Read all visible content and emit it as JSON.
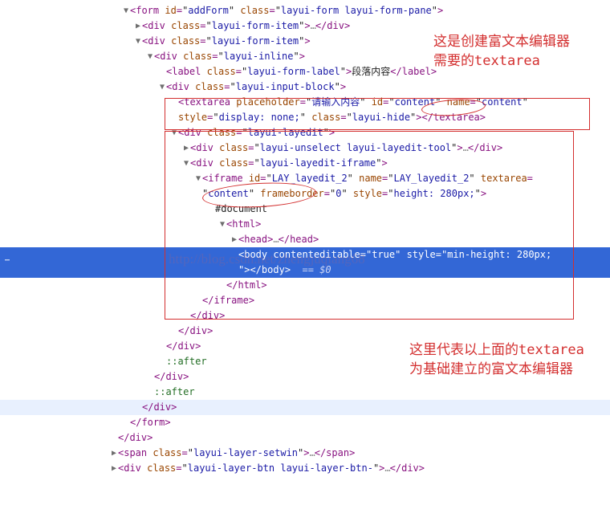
{
  "tree": {
    "form": {
      "id": "addForm",
      "class": "layui-form layui-form-pane"
    },
    "divA": {
      "class": "layui-form-item"
    },
    "divB": {
      "class": "layui-form-item"
    },
    "divC": {
      "class": "layui-inline"
    },
    "label": {
      "class": "layui-form-label",
      "text": "段落内容"
    },
    "divD": {
      "class": "layui-input-block"
    },
    "textarea": {
      "placeholder": "请输入内容",
      "id": "content",
      "name": "content",
      "style": "display: none;",
      "class": "layui-hide"
    },
    "divE": {
      "class": "layui-layedit"
    },
    "divF": {
      "class": "layui-unselect layui-layedit-tool"
    },
    "divG": {
      "class": "layui-layedit-iframe"
    },
    "iframe": {
      "id": "LAY_layedit_2",
      "name": "LAY_layedit_2",
      "textarea": "content",
      "frameborder": "0",
      "style": "height: 280px;"
    },
    "document": "#document",
    "body": {
      "contenteditable": "true",
      "style": "min-height: 280px;"
    },
    "eqzero": "== $0",
    "after": "::after",
    "span": {
      "class": "layui-layer-setwin"
    },
    "btn": {
      "class": "layui-layer-btn layui-layer-btn-"
    }
  },
  "anno1_l1": "这是创建富文本编辑器",
  "anno1_l2a": "需要的",
  "anno1_l2b": "textarea",
  "anno2_l1a": "这里代表以上面的",
  "anno2_l1b": "textarea",
  "anno2_l2": "为基础建立的富文本编辑器",
  "watermark": "http://blog.csdn.net/zhengjuqiang68"
}
